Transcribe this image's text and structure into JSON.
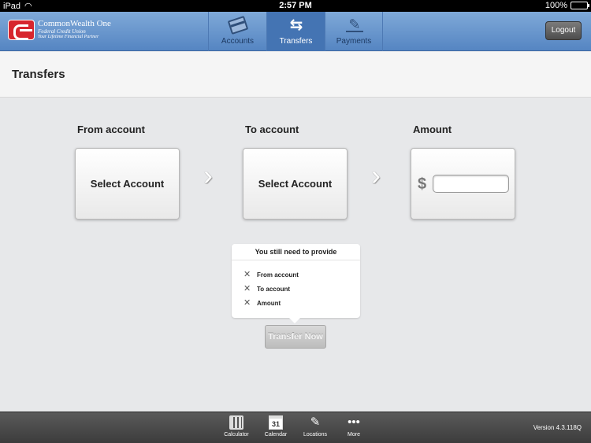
{
  "statusbar": {
    "device": "iPad",
    "time": "2:57 PM",
    "battery": "100%"
  },
  "brand": {
    "line1": "CommonWealth One",
    "line2": "Federal Credit Union",
    "line3": "Your Lifetime Financial Partner"
  },
  "tabs": [
    {
      "label": "Accounts",
      "icon": "credit-card-icon"
    },
    {
      "label": "Transfers",
      "icon": "transfer-arrows-icon",
      "active": true
    },
    {
      "label": "Payments",
      "icon": "bill-pay-icon"
    }
  ],
  "header": {
    "logout_label": "Logout"
  },
  "page": {
    "title": "Transfers"
  },
  "transfer": {
    "from_label": "From account",
    "to_label": "To account",
    "amount_label": "Amount",
    "from_button": "Select Account",
    "to_button": "Select Account",
    "currency": "$",
    "amount_value": ""
  },
  "provide": {
    "heading": "You still need to provide",
    "items": [
      "From account",
      "To account",
      "Amount"
    ]
  },
  "actions": {
    "transfer_now": "Transfer Now"
  },
  "toolbar": {
    "items": [
      {
        "label": "Calculator",
        "icon": "calculator-icon"
      },
      {
        "label": "Calendar",
        "icon": "calendar-icon",
        "glyph": "31"
      },
      {
        "label": "Locations",
        "icon": "location-pin-icon"
      },
      {
        "label": "More",
        "icon": "more-dots-icon"
      }
    ],
    "version": "Version 4.3.118Q"
  }
}
